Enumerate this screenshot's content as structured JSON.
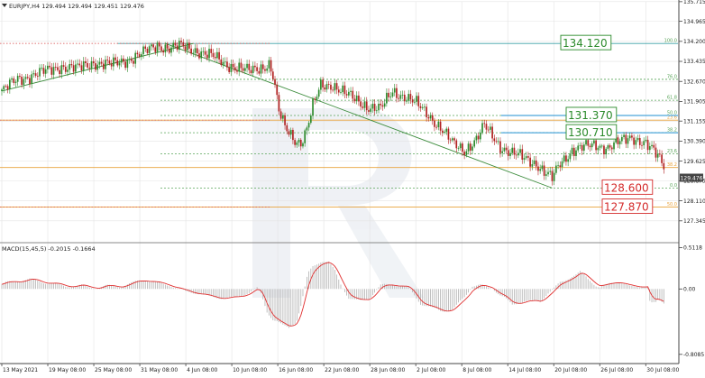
{
  "colors": {
    "bull": "#2e8b2e",
    "bear": "#b22222",
    "grid": "#e3e3e3",
    "fib": "#5aa55a",
    "orange": "#e8a23a",
    "trendline": "#3c8c3c",
    "blue": "#1f8fd1",
    "red_dotted": "#d64545",
    "macd_hist": "#b0b0b0",
    "macd_signal": "#e03030",
    "label_green": "#2a8a2a",
    "label_red": "#d42a2a"
  },
  "header": {
    "main": "EURJPY,H4  129.494 129.494 129.451 129.476",
    "macd": "MACD(15,45,5) -0.2015 -0.1664"
  },
  "chart_data": [
    {
      "type": "candlestick",
      "symbol": "EURJPY",
      "timeframe": "H4",
      "ohlc_header": [
        129.494,
        129.494,
        129.451,
        129.476
      ],
      "ylim": [
        126.58,
        135.71
      ],
      "y_ticks": [
        "135.715",
        "134.965",
        "134.200",
        "133.435",
        "132.670",
        "131.905",
        "131.155",
        "130.390",
        "129.625",
        "128.875",
        "128.110",
        "127.345"
      ],
      "x_ticks": [
        "13 May 2021",
        "19 May 08:00",
        "25 May 08:00",
        "31 May 08:00",
        "4 Jun 08:00",
        "10 Jun 08:00",
        "16 Jun 08:00",
        "22 Jun 08:00",
        "28 Jun 08:00",
        "2 Jul 08:00",
        "8 Jul 08:00",
        "14 Jul 08:00",
        "20 Jul 08:00",
        "26 Jul 08:00",
        "30 Jul 08:00"
      ],
      "price_path": [
        [
          0,
          132.3
        ],
        [
          8,
          132.75
        ],
        [
          15,
          132.9
        ],
        [
          22,
          133.05
        ],
        [
          30,
          133.25
        ],
        [
          38,
          133.15
        ],
        [
          46,
          133.4
        ],
        [
          55,
          133.3
        ],
        [
          63,
          133.5
        ],
        [
          71,
          133.75
        ],
        [
          78,
          134.05
        ],
        [
          84,
          133.95
        ],
        [
          90,
          134.0
        ],
        [
          98,
          133.85
        ],
        [
          106,
          133.6
        ],
        [
          112,
          133.35
        ],
        [
          118,
          133.2
        ],
        [
          124,
          133.05
        ],
        [
          130,
          133.2
        ],
        [
          134,
          133.35
        ],
        [
          136,
          132.9
        ],
        [
          139,
          131.5
        ],
        [
          142,
          130.9
        ],
        [
          147,
          130.45
        ],
        [
          150,
          130.35
        ],
        [
          153,
          130.85
        ],
        [
          156,
          131.7
        ],
        [
          160,
          132.5
        ],
        [
          166,
          132.55
        ],
        [
          172,
          132.2
        ],
        [
          178,
          131.95
        ],
        [
          184,
          131.7
        ],
        [
          190,
          131.6
        ],
        [
          196,
          132.3
        ],
        [
          202,
          132.1
        ],
        [
          208,
          131.8
        ],
        [
          214,
          131.4
        ],
        [
          220,
          130.9
        ],
        [
          226,
          130.3
        ],
        [
          232,
          130.05
        ],
        [
          238,
          130.45
        ],
        [
          242,
          130.95
        ],
        [
          246,
          130.6
        ],
        [
          250,
          130.2
        ],
        [
          256,
          129.9
        ],
        [
          262,
          129.75
        ],
        [
          268,
          129.55
        ],
        [
          272,
          129.2
        ],
        [
          276,
          128.95
        ],
        [
          280,
          129.55
        ],
        [
          286,
          130.05
        ],
        [
          292,
          130.15
        ],
        [
          298,
          130.25
        ],
        [
          304,
          130.15
        ],
        [
          310,
          130.35
        ],
        [
          316,
          130.55
        ],
        [
          322,
          130.35
        ],
        [
          326,
          130.05
        ],
        [
          330,
          129.7
        ],
        [
          332,
          129.48
        ]
      ],
      "last_price": "129.476",
      "fib_levels_upper": [
        {
          "label": "100.0",
          "value": 134.12
        },
        {
          "label": "76.0",
          "value": 132.75
        },
        {
          "label": "61.8",
          "value": 131.95
        },
        {
          "label": "50.0",
          "value": 131.37
        },
        {
          "label": "38.2",
          "value": 130.71
        },
        {
          "label": "23.6",
          "value": 129.9
        },
        {
          "label": "0.0",
          "value": 128.6
        }
      ],
      "fib_levels_lower": [
        {
          "label": "23.6",
          "value": 131.19
        },
        {
          "label": "38.2",
          "value": 129.38
        },
        {
          "label": "50.0",
          "value": 127.87
        }
      ],
      "annotations": [
        {
          "text": "134.120",
          "value": 134.12,
          "color": "green"
        },
        {
          "text": "131.370",
          "value": 131.37,
          "color": "green"
        },
        {
          "text": "130.710",
          "value": 130.71,
          "color": "green"
        },
        {
          "text": "128.600",
          "value": 128.6,
          "color": "red"
        },
        {
          "text": "127.870",
          "value": 127.87,
          "color": "red"
        }
      ],
      "trendlines": [
        {
          "from": [
            0,
            132.3
          ],
          "to": [
            96,
            134.12
          ]
        },
        {
          "from": [
            82,
            134.12
          ],
          "to": [
            276,
            128.6
          ]
        }
      ]
    },
    {
      "type": "histogram",
      "title": "MACD(15,45,5)",
      "values_header": [
        -0.2015,
        -0.1664
      ],
      "ylim": [
        -0.9,
        0.55
      ],
      "y_ticks": [
        "0.5118",
        "0.00",
        "-0.8085"
      ]
    }
  ]
}
